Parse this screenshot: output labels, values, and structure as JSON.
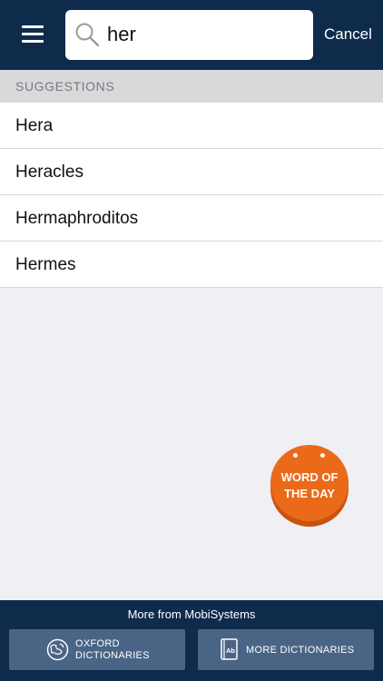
{
  "search": {
    "value": "her",
    "cancel_label": "Cancel",
    "icon": "search-icon"
  },
  "menu": {
    "icon": "hamburger-menu-icon"
  },
  "suggestions": {
    "header": "SUGGESTIONS",
    "items": [
      {
        "label": "Hera"
      },
      {
        "label": "Heracles"
      },
      {
        "label": "Hermaphroditos"
      },
      {
        "label": "Hermes"
      }
    ]
  },
  "word_of_day": {
    "line1": "WORD OF",
    "line2": "THE DAY"
  },
  "footer": {
    "title": "More from MobiSystems",
    "oxford": {
      "line1": "OXFORD",
      "line2": "DICTIONARIES",
      "icon": "globe-icon"
    },
    "more": {
      "label": "MORE DICTIONARIES",
      "icon": "book-icon"
    }
  },
  "colors": {
    "header_bg": "#0f2b4c",
    "accent_orange": "#ea6a19",
    "footer_button_bg": "#4a6485"
  }
}
